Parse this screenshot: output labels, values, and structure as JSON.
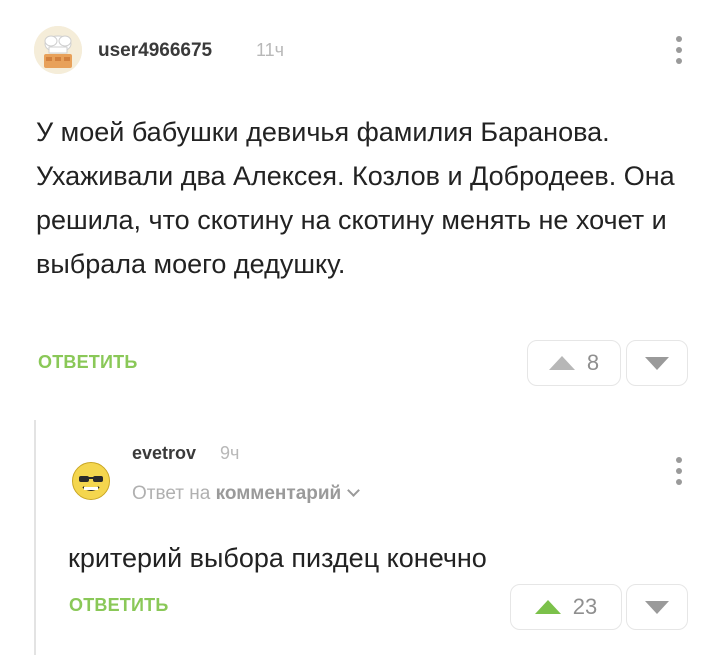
{
  "comments": [
    {
      "username": "user4966675",
      "time": "11ч",
      "text": "У моей бабушки девичья фамилия Баранова. Ухаживали два Алексея. Козлов и  Добродеев. Она решила, что скотину на скотину менять не хочет и выбрала моего дедушку.",
      "reply_label": "ОТВЕТИТЬ",
      "score": "8",
      "avatar_icon": "chef-hat-avatar-icon"
    },
    {
      "username": "evetrov",
      "time": "9ч",
      "reply_to_prefix": "Ответ на",
      "reply_to_target": "комментарий",
      "text": "критерий выбора пиздец конечно",
      "reply_label": "ОТВЕТИТЬ",
      "score": "23",
      "avatar_icon": "smiley-sunglasses-avatar-icon"
    }
  ],
  "colors": {
    "accent_green": "#8ac858",
    "upvote_active": "#7bc14a",
    "muted_text": "#b8b8b8"
  }
}
